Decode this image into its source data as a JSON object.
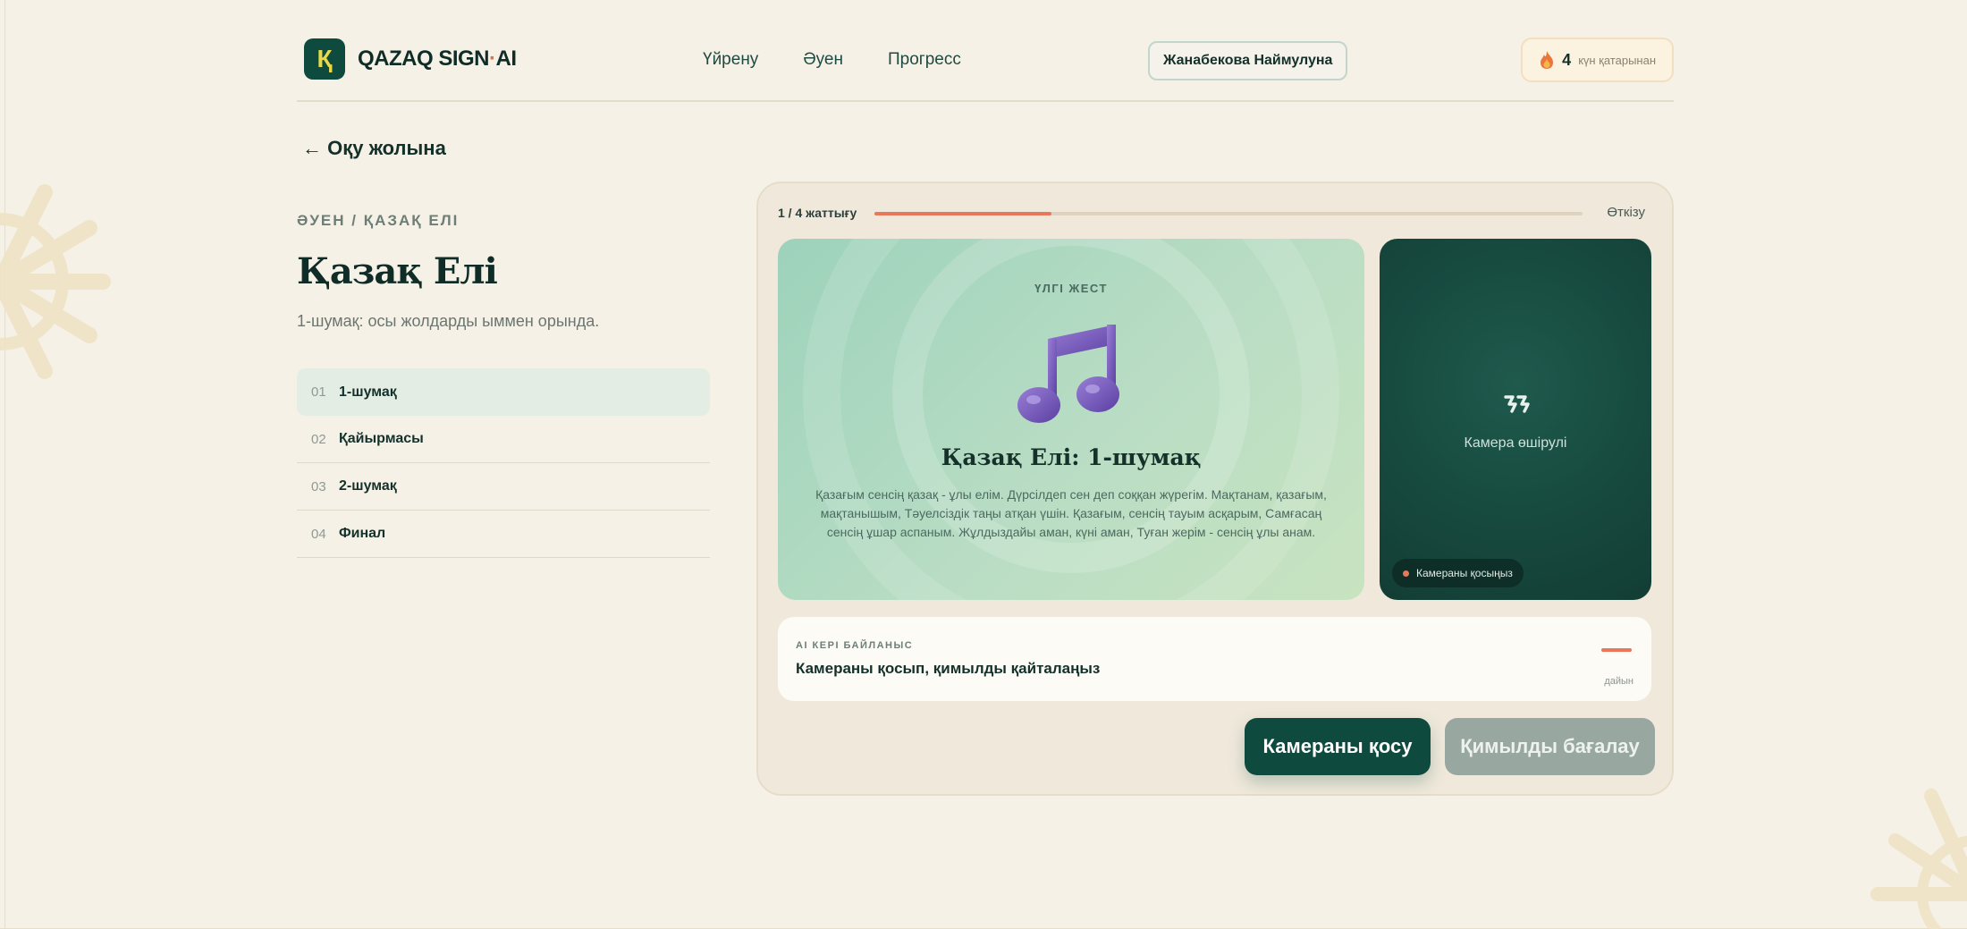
{
  "brand": {
    "mark": "Қ",
    "name_main": "QAZAQ SIGN",
    "name_dot": "·",
    "name_tail": "AI"
  },
  "nav": {
    "items": [
      "Үйрену",
      "Әуен",
      "Прогресс"
    ]
  },
  "user": {
    "name": "Жанабекова Наймулуна"
  },
  "streak": {
    "count": "4",
    "label": "күн қатарынан"
  },
  "back_link": "← Оқу жолына",
  "lesson": {
    "breadcrumb": "ӘУЕН / ҚАЗАҚ ЕЛІ",
    "title": "Қазақ Елі",
    "subtitle": "1-шумақ: осы жолдарды ыммен орында.",
    "parts": [
      {
        "num": "01",
        "label": "1-шумақ",
        "active": true
      },
      {
        "num": "02",
        "label": "Қайырмасы",
        "active": false
      },
      {
        "num": "03",
        "label": "2-шумақ",
        "active": false
      },
      {
        "num": "04",
        "label": "Финал",
        "active": false
      }
    ]
  },
  "exercise": {
    "step": "1 / 4 жаттығу",
    "progress": 0.25,
    "skip": "Өткізу",
    "demo_label": "ҮЛГІ ЖЕСТ",
    "demo_title": "Қазақ Елі: 1-шумақ",
    "lyrics": "Қазағым сенсің қазақ - ұлы елім. Дүрсілдеп сен деп соққан жүрегім. Мақтанам, қазағым, мақтанышым, Тәуелсіздік таңы атқан үшін. Қазағым, сенсің тауым асқарым, Самғасаң сенсің ұшар аспаным. Жұлдыздайы аман, күні аман, Туған жерім - сенсің ұлы анам.",
    "camera_off": "Камера өшірулі",
    "camera_pill": "Камераны қосыңыз",
    "feedback_caption": "AI КЕРІ БАЙЛАНЫС",
    "feedback_message": "Камераны қосып, қимылды қайталаңыз",
    "feedback_status": "дайын",
    "btn_camera": "Камераны қосу",
    "btn_evaluate": "Қимылды бағалау"
  },
  "colors": {
    "accent": "#e9775a",
    "brand": "#0f4a3f",
    "background": "#f6f1e6"
  },
  "icons": [
    "music-note-icon",
    "camera-off-icon",
    "flame-icon",
    "sun-ornament-icon"
  ]
}
